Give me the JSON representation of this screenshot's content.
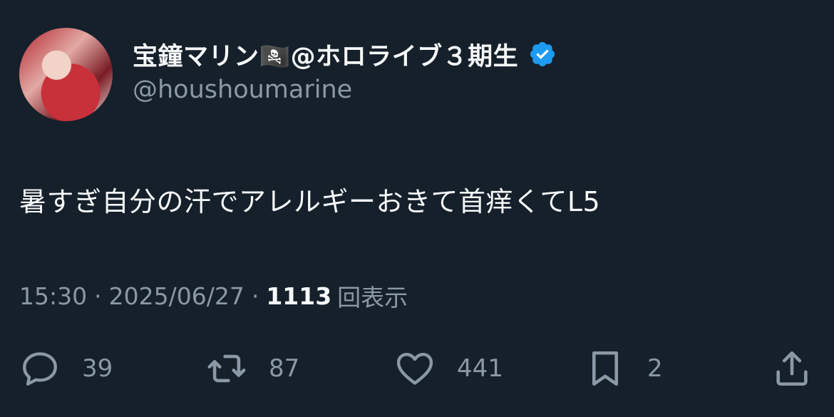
{
  "user": {
    "display_name": "宝鐘マリン🏴‍☠️@ホロライブ３期生",
    "handle": "@houshoumarine",
    "verified_icon": "verified-badge-icon",
    "verified_color": "#1d9bf0"
  },
  "tweet": {
    "text": "暑すぎ自分の汗でアレルギーおきて首痒くてL5"
  },
  "meta": {
    "time": "15:30",
    "separator": "·",
    "date": "2025/06/27",
    "views_count": "1113",
    "views_label": "回表示"
  },
  "actions": {
    "reply": {
      "icon": "reply-icon",
      "count": "39"
    },
    "retweet": {
      "icon": "retweet-icon",
      "count": "87"
    },
    "like": {
      "icon": "heart-icon",
      "count": "441"
    },
    "bookmark": {
      "icon": "bookmark-icon",
      "count": "2"
    },
    "share": {
      "icon": "share-icon"
    }
  },
  "colors": {
    "background": "#15202b",
    "primary_text": "#f7f9f9",
    "secondary_text": "#8b98a5"
  }
}
